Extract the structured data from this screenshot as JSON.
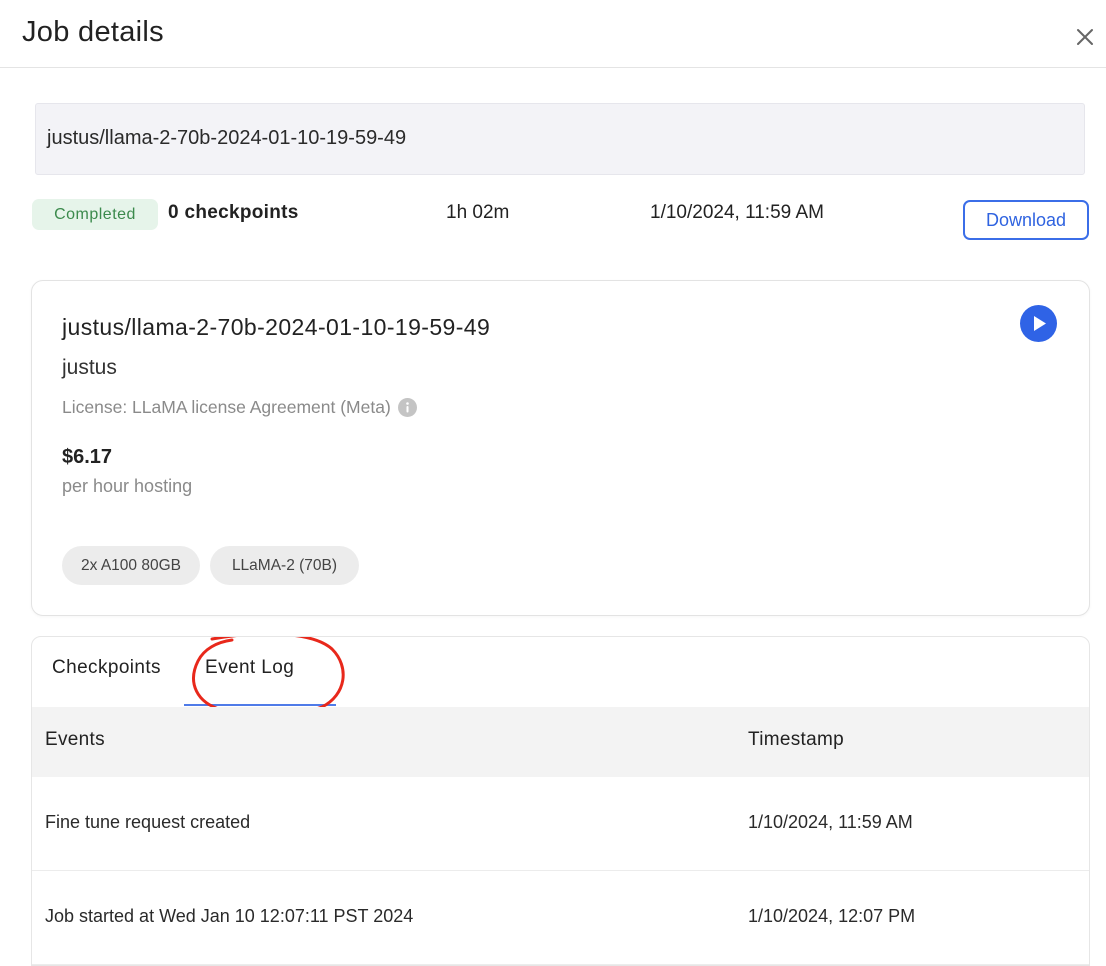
{
  "header": {
    "title": "Job details",
    "close_icon": "close-icon"
  },
  "job": {
    "name": "justus/llama-2-70b-2024-01-10-19-59-49",
    "status": "Completed",
    "checkpoints": "0 checkpoints",
    "duration": "1h 02m",
    "created_at": "1/10/2024, 11:59 AM",
    "download_label": "Download"
  },
  "model_card": {
    "title": "justus/llama-2-70b-2024-01-10-19-59-49",
    "owner": "justus",
    "license": "License: LLaMA license Agreement (Meta)",
    "price": "$6.17",
    "price_note": "per hour hosting",
    "tags": [
      "2x A100 80GB",
      "LLaMA-2 (70B)"
    ],
    "play_icon": "play-icon",
    "info_icon": "info-icon"
  },
  "tabs": {
    "items": [
      "Checkpoints",
      "Event Log"
    ],
    "active": "Event Log"
  },
  "event_table": {
    "columns": [
      "Events",
      "Timestamp"
    ],
    "rows": [
      {
        "event": "Fine tune request created",
        "timestamp": "1/10/2024, 11:59 AM"
      },
      {
        "event": "Job started at Wed Jan 10 12:07:11 PST 2024",
        "timestamp": "1/10/2024, 12:07 PM"
      }
    ]
  },
  "colors": {
    "accent": "#2f63e6",
    "status_bg": "#e6f4ea",
    "status_text": "#3b8a4c",
    "annotation": "#e8281b"
  }
}
